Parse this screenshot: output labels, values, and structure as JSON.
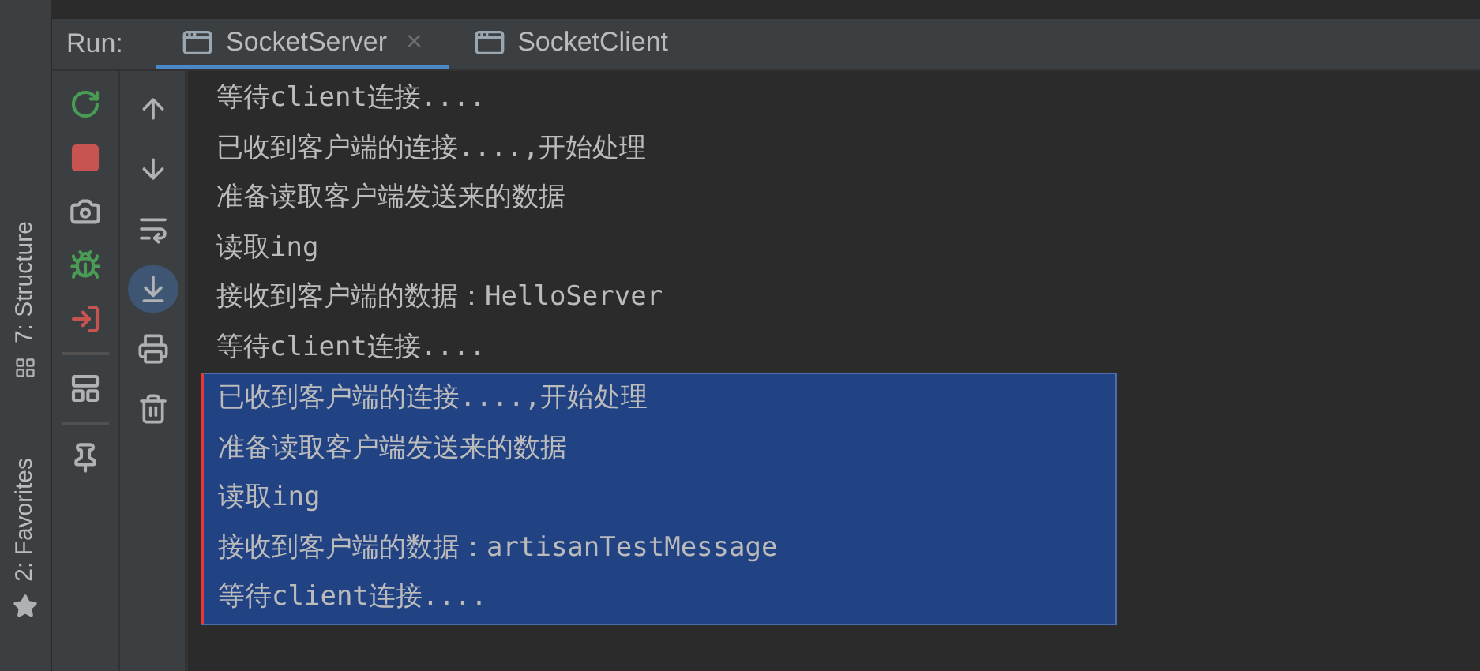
{
  "tool_windows": [
    {
      "kind": "structure",
      "label": "7: Structure"
    },
    {
      "kind": "favorites",
      "label": "2: Favorites"
    }
  ],
  "run_panel": {
    "label": "Run:",
    "tabs": [
      {
        "label": "SocketServer",
        "selected": true,
        "close": "×"
      },
      {
        "label": "SocketClient",
        "selected": false
      }
    ]
  },
  "toolbar_left": [
    {
      "kind": "rerun"
    },
    {
      "kind": "stop"
    },
    {
      "kind": "camera"
    },
    {
      "kind": "debug"
    },
    {
      "kind": "exit"
    },
    {
      "kind": "divider"
    },
    {
      "kind": "layout"
    },
    {
      "kind": "divider"
    },
    {
      "kind": "pin"
    }
  ],
  "toolbar_right": [
    {
      "kind": "up",
      "on": false
    },
    {
      "kind": "down",
      "on": false
    },
    {
      "kind": "wrap",
      "on": false
    },
    {
      "kind": "scroll_end",
      "on": true
    },
    {
      "kind": "print",
      "on": false
    },
    {
      "kind": "trash",
      "on": false
    }
  ],
  "console": {
    "lines": [
      {
        "text": "等待client连接....",
        "selected": false
      },
      {
        "text": "已收到客户端的连接....,开始处理",
        "selected": false
      },
      {
        "text": "准备读取客户端发送来的数据",
        "selected": false
      },
      {
        "text": "读取ing",
        "selected": false
      },
      {
        "text": "接收到客户端的数据：HelloServer",
        "selected": false
      },
      {
        "text": "等待client连接....",
        "selected": false
      },
      {
        "text": "已收到客户端的连接....,开始处理",
        "selected": true
      },
      {
        "text": "准备读取客户端发送来的数据",
        "selected": true
      },
      {
        "text": "读取ing",
        "selected": true
      },
      {
        "text": "接收到客户端的数据：artisanTestMessage",
        "selected": true
      },
      {
        "text": "等待client连接....",
        "selected": true
      }
    ]
  }
}
